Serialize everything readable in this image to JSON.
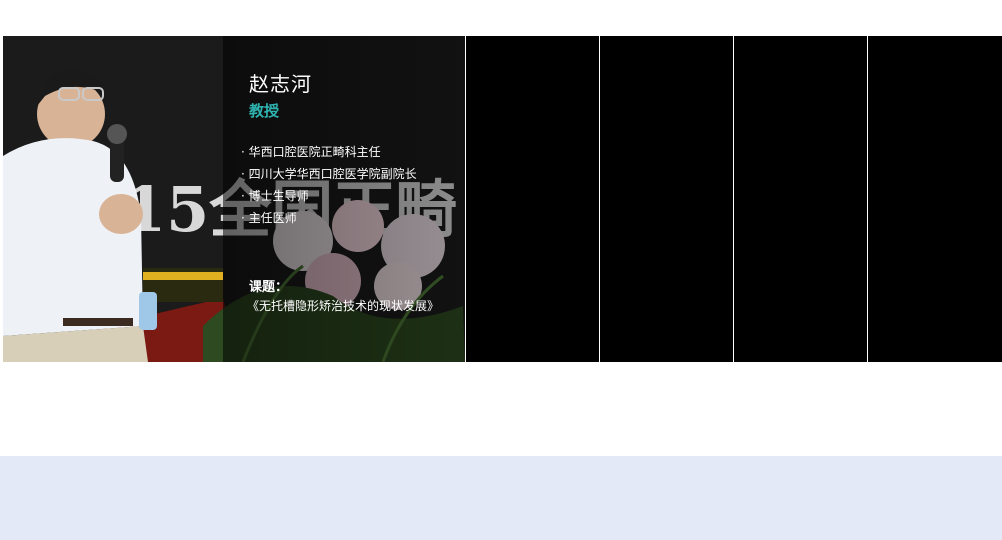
{
  "slides": {
    "featured": {
      "name": "赵志河",
      "title": "教授",
      "bio": [
        "华西口腔医院正畸科主任",
        "四川大学华西口腔医学院副院长",
        "博士生导师",
        "主任医师"
      ],
      "topic_label": "课题：",
      "topic": "《无托槽隐形矫治技术的现状发展》",
      "backdrop_text": "15全国正畸"
    },
    "thumbnails": [
      {
        "label": ""
      },
      {
        "label": ""
      },
      {
        "label": ""
      },
      {
        "label": ""
      }
    ]
  },
  "colors": {
    "accent_title": "#2fb3b0",
    "footer_band": "#e4e9f7"
  }
}
